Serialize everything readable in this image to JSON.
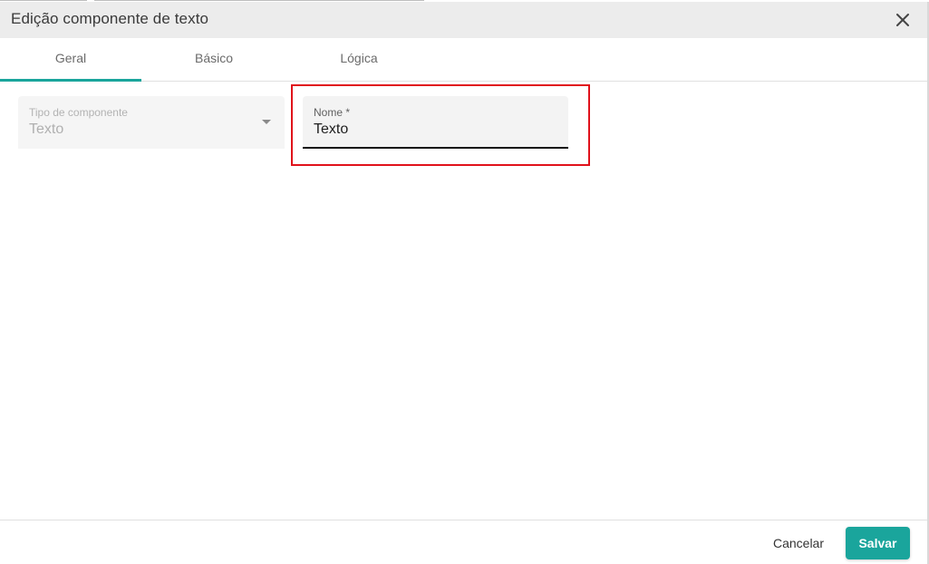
{
  "dialog": {
    "title": "Edição componente de texto",
    "close_icon": "close-icon"
  },
  "tabs": [
    {
      "label": "Geral",
      "active": true
    },
    {
      "label": "Básico",
      "active": false
    },
    {
      "label": "Lógica",
      "active": false
    }
  ],
  "form": {
    "tipo": {
      "label": "Tipo de componente",
      "value": "Texto",
      "disabled": true
    },
    "nome": {
      "label": "Nome *",
      "value": "Texto"
    }
  },
  "footer": {
    "cancel_label": "Cancelar",
    "save_label": "Salvar"
  },
  "colors": {
    "accent": "#1aa59c",
    "highlight": "#e0121b",
    "header_bg": "#ececec"
  }
}
